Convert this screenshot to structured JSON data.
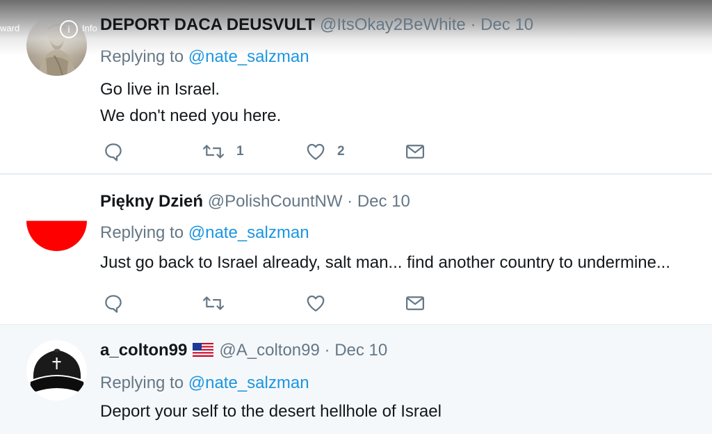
{
  "video_controls": {
    "forward_label": "ward",
    "info_label": "Info",
    "info_icon": "info-icon"
  },
  "tweets": [
    {
      "name": "DEPORT DACA DEUSVULT",
      "handle": "@ItsOkay2BeWhite",
      "date": "· Dec 10",
      "replying_prefix": "Replying to",
      "replying_to": "@nate_salzman",
      "lines": [
        "Go live in Israel.",
        "We don't need you here."
      ],
      "reply_count": "",
      "retweet_count": "1",
      "like_count": "2",
      "avatar": "statue-avatar"
    },
    {
      "name": "Piękny Dzień",
      "handle": "@PolishCountNW",
      "date": "· Dec 10",
      "replying_prefix": "Replying to",
      "replying_to": "@nate_salzman",
      "lines": [
        "Just go back to Israel already, salt man... find another country to undermine..."
      ],
      "reply_count": "",
      "retweet_count": "",
      "like_count": "",
      "avatar": "polish-flag-avatar",
      "avatar_colors": {
        "top": "#ffffff",
        "bottom": "#ff0000"
      }
    },
    {
      "name": "a_colton99",
      "flag": "us-flag-icon",
      "handle": "@A_colton99",
      "date": "· Dec 10",
      "replying_prefix": "Replying to",
      "replying_to": "@nate_salzman",
      "lines": [
        "Deport your self to the desert hellhole of Israel"
      ],
      "avatar": "black-cap-avatar"
    }
  ],
  "colors": {
    "link": "#1b95e0",
    "secondary_text": "#657786",
    "primary_text": "#14171a",
    "divider": "#e6ecf0",
    "highlight_bg": "#f5f8fa"
  }
}
